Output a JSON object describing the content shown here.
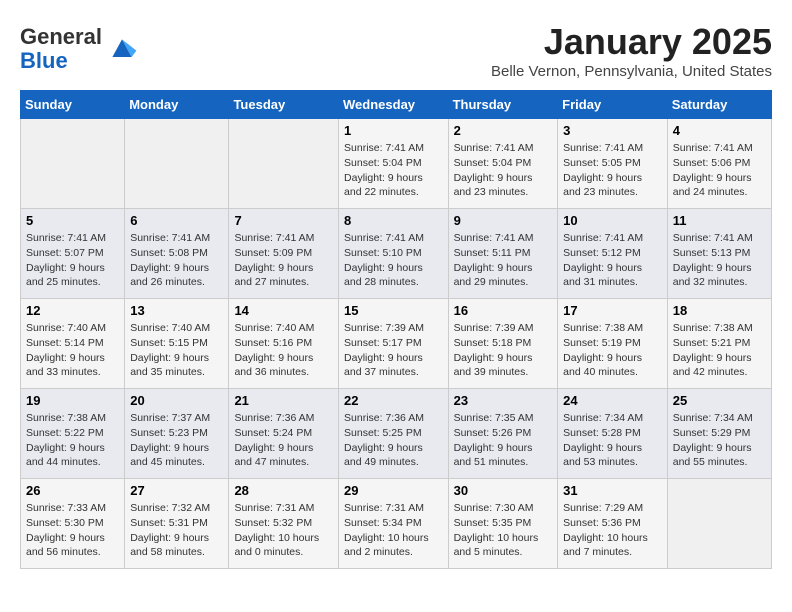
{
  "header": {
    "logo_line1": "General",
    "logo_line2": "Blue",
    "month_title": "January 2025",
    "location": "Belle Vernon, Pennsylvania, United States"
  },
  "weekdays": [
    "Sunday",
    "Monday",
    "Tuesday",
    "Wednesday",
    "Thursday",
    "Friday",
    "Saturday"
  ],
  "weeks": [
    [
      {
        "day": "",
        "content": ""
      },
      {
        "day": "",
        "content": ""
      },
      {
        "day": "",
        "content": ""
      },
      {
        "day": "1",
        "content": "Sunrise: 7:41 AM\nSunset: 5:04 PM\nDaylight: 9 hours\nand 22 minutes."
      },
      {
        "day": "2",
        "content": "Sunrise: 7:41 AM\nSunset: 5:04 PM\nDaylight: 9 hours\nand 23 minutes."
      },
      {
        "day": "3",
        "content": "Sunrise: 7:41 AM\nSunset: 5:05 PM\nDaylight: 9 hours\nand 23 minutes."
      },
      {
        "day": "4",
        "content": "Sunrise: 7:41 AM\nSunset: 5:06 PM\nDaylight: 9 hours\nand 24 minutes."
      }
    ],
    [
      {
        "day": "5",
        "content": "Sunrise: 7:41 AM\nSunset: 5:07 PM\nDaylight: 9 hours\nand 25 minutes."
      },
      {
        "day": "6",
        "content": "Sunrise: 7:41 AM\nSunset: 5:08 PM\nDaylight: 9 hours\nand 26 minutes."
      },
      {
        "day": "7",
        "content": "Sunrise: 7:41 AM\nSunset: 5:09 PM\nDaylight: 9 hours\nand 27 minutes."
      },
      {
        "day": "8",
        "content": "Sunrise: 7:41 AM\nSunset: 5:10 PM\nDaylight: 9 hours\nand 28 minutes."
      },
      {
        "day": "9",
        "content": "Sunrise: 7:41 AM\nSunset: 5:11 PM\nDaylight: 9 hours\nand 29 minutes."
      },
      {
        "day": "10",
        "content": "Sunrise: 7:41 AM\nSunset: 5:12 PM\nDaylight: 9 hours\nand 31 minutes."
      },
      {
        "day": "11",
        "content": "Sunrise: 7:41 AM\nSunset: 5:13 PM\nDaylight: 9 hours\nand 32 minutes."
      }
    ],
    [
      {
        "day": "12",
        "content": "Sunrise: 7:40 AM\nSunset: 5:14 PM\nDaylight: 9 hours\nand 33 minutes."
      },
      {
        "day": "13",
        "content": "Sunrise: 7:40 AM\nSunset: 5:15 PM\nDaylight: 9 hours\nand 35 minutes."
      },
      {
        "day": "14",
        "content": "Sunrise: 7:40 AM\nSunset: 5:16 PM\nDaylight: 9 hours\nand 36 minutes."
      },
      {
        "day": "15",
        "content": "Sunrise: 7:39 AM\nSunset: 5:17 PM\nDaylight: 9 hours\nand 37 minutes."
      },
      {
        "day": "16",
        "content": "Sunrise: 7:39 AM\nSunset: 5:18 PM\nDaylight: 9 hours\nand 39 minutes."
      },
      {
        "day": "17",
        "content": "Sunrise: 7:38 AM\nSunset: 5:19 PM\nDaylight: 9 hours\nand 40 minutes."
      },
      {
        "day": "18",
        "content": "Sunrise: 7:38 AM\nSunset: 5:21 PM\nDaylight: 9 hours\nand 42 minutes."
      }
    ],
    [
      {
        "day": "19",
        "content": "Sunrise: 7:38 AM\nSunset: 5:22 PM\nDaylight: 9 hours\nand 44 minutes."
      },
      {
        "day": "20",
        "content": "Sunrise: 7:37 AM\nSunset: 5:23 PM\nDaylight: 9 hours\nand 45 minutes."
      },
      {
        "day": "21",
        "content": "Sunrise: 7:36 AM\nSunset: 5:24 PM\nDaylight: 9 hours\nand 47 minutes."
      },
      {
        "day": "22",
        "content": "Sunrise: 7:36 AM\nSunset: 5:25 PM\nDaylight: 9 hours\nand 49 minutes."
      },
      {
        "day": "23",
        "content": "Sunrise: 7:35 AM\nSunset: 5:26 PM\nDaylight: 9 hours\nand 51 minutes."
      },
      {
        "day": "24",
        "content": "Sunrise: 7:34 AM\nSunset: 5:28 PM\nDaylight: 9 hours\nand 53 minutes."
      },
      {
        "day": "25",
        "content": "Sunrise: 7:34 AM\nSunset: 5:29 PM\nDaylight: 9 hours\nand 55 minutes."
      }
    ],
    [
      {
        "day": "26",
        "content": "Sunrise: 7:33 AM\nSunset: 5:30 PM\nDaylight: 9 hours\nand 56 minutes."
      },
      {
        "day": "27",
        "content": "Sunrise: 7:32 AM\nSunset: 5:31 PM\nDaylight: 9 hours\nand 58 minutes."
      },
      {
        "day": "28",
        "content": "Sunrise: 7:31 AM\nSunset: 5:32 PM\nDaylight: 10 hours\nand 0 minutes."
      },
      {
        "day": "29",
        "content": "Sunrise: 7:31 AM\nSunset: 5:34 PM\nDaylight: 10 hours\nand 2 minutes."
      },
      {
        "day": "30",
        "content": "Sunrise: 7:30 AM\nSunset: 5:35 PM\nDaylight: 10 hours\nand 5 minutes."
      },
      {
        "day": "31",
        "content": "Sunrise: 7:29 AM\nSunset: 5:36 PM\nDaylight: 10 hours\nand 7 minutes."
      },
      {
        "day": "",
        "content": ""
      }
    ]
  ]
}
